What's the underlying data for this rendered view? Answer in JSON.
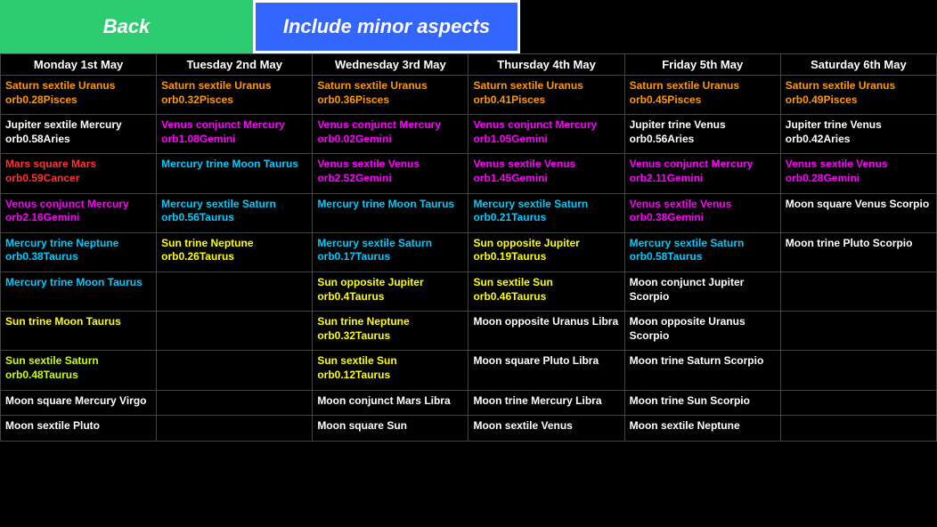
{
  "topbar": {
    "back_label": "Back",
    "minor_label": "Include minor aspects"
  },
  "headers": [
    "Monday 1st May",
    "Tuesday 2nd May",
    "Wednesday 3rd May",
    "Thursday 4th May",
    "Friday 5th May",
    "Saturday 6th May"
  ],
  "rows": [
    [
      [
        {
          "text": "Saturn sextile Uranus orb0.28Pisces",
          "color": "orange"
        }
      ],
      [
        {
          "text": "Saturn sextile Uranus orb0.32Pisces",
          "color": "orange"
        }
      ],
      [
        {
          "text": "Saturn sextile Uranus orb0.36Pisces",
          "color": "orange"
        }
      ],
      [
        {
          "text": "Saturn sextile Uranus orb0.41Pisces",
          "color": "orange"
        }
      ],
      [
        {
          "text": "Saturn sextile Uranus orb0.45Pisces",
          "color": "orange"
        }
      ],
      [
        {
          "text": "Saturn sextile Uranus orb0.49Pisces",
          "color": "orange"
        }
      ]
    ],
    [
      [
        {
          "text": "Jupiter sextile Mercury orb0.58Aries",
          "color": "white"
        }
      ],
      [
        {
          "text": "Venus conjunct Mercury orb1.08Gemini",
          "color": "magenta"
        }
      ],
      [
        {
          "text": "Venus conjunct Mercury orb0.02Gemini",
          "color": "magenta"
        }
      ],
      [
        {
          "text": "Venus conjunct Mercury orb1.05Gemini",
          "color": "magenta"
        }
      ],
      [
        {
          "text": "Jupiter trine Venus orb0.56Aries",
          "color": "white"
        }
      ],
      [
        {
          "text": "Jupiter trine Venus orb0.42Aries",
          "color": "white"
        }
      ]
    ],
    [
      [
        {
          "text": "Mars square Mars orb0.59Cancer",
          "color": "red"
        }
      ],
      [
        {
          "text": "Mercury trine Moon Taurus",
          "color": "cyan"
        }
      ],
      [
        {
          "text": "Venus sextile Venus orb2.52Gemini",
          "color": "magenta"
        }
      ],
      [
        {
          "text": "Venus sextile Venus orb1.45Gemini",
          "color": "magenta"
        }
      ],
      [
        {
          "text": "Venus conjunct Mercury orb2.11Gemini",
          "color": "magenta"
        }
      ],
      [
        {
          "text": "Venus sextile Venus orb0.28Gemini",
          "color": "magenta"
        }
      ]
    ],
    [
      [
        {
          "text": "Venus conjunct Mercury orb2.16Gemini",
          "color": "magenta"
        }
      ],
      [
        {
          "text": "Mercury sextile Saturn orb0.56Taurus",
          "color": "cyan"
        }
      ],
      [
        {
          "text": "Mercury trine Moon Taurus",
          "color": "cyan"
        }
      ],
      [
        {
          "text": "Mercury sextile Saturn orb0.21Taurus",
          "color": "cyan"
        }
      ],
      [
        {
          "text": "Venus sextile Venus orb0.38Gemini",
          "color": "magenta"
        }
      ],
      [
        {
          "text": "Moon square Venus Scorpio",
          "color": "white"
        }
      ]
    ],
    [
      [
        {
          "text": "Mercury trine Neptune orb0.38Taurus",
          "color": "cyan"
        }
      ],
      [
        {
          "text": "Sun trine Neptune orb0.26Taurus",
          "color": "yellow"
        }
      ],
      [
        {
          "text": "Mercury sextile Saturn orb0.17Taurus",
          "color": "cyan"
        }
      ],
      [
        {
          "text": "Sun opposite Jupiter orb0.19Taurus",
          "color": "yellow"
        }
      ],
      [
        {
          "text": "Mercury sextile Saturn orb0.58Taurus",
          "color": "cyan"
        }
      ],
      [
        {
          "text": "Moon trine Pluto Scorpio",
          "color": "white"
        }
      ]
    ],
    [
      [
        {
          "text": "Mercury trine Moon Taurus",
          "color": "cyan"
        }
      ],
      [],
      [
        {
          "text": "Sun opposite Jupiter orb0.4Taurus",
          "color": "yellow"
        }
      ],
      [
        {
          "text": "Sun sextile Sun orb0.46Taurus",
          "color": "yellow"
        }
      ],
      [
        {
          "text": "Moon conjunct Jupiter Scorpio",
          "color": "white"
        }
      ],
      []
    ],
    [
      [
        {
          "text": "Sun trine Moon Taurus",
          "color": "yellow"
        }
      ],
      [],
      [
        {
          "text": "Sun trine Neptune orb0.32Taurus",
          "color": "yellow"
        }
      ],
      [
        {
          "text": "Moon opposite Uranus Libra",
          "color": "white"
        }
      ],
      [
        {
          "text": "Moon opposite Uranus Scorpio",
          "color": "white"
        }
      ],
      []
    ],
    [
      [
        {
          "text": "Sun sextile Saturn orb0.48Taurus",
          "color": "lime"
        }
      ],
      [],
      [
        {
          "text": "Sun sextile Sun orb0.12Taurus",
          "color": "yellow"
        }
      ],
      [
        {
          "text": "Moon square Pluto Libra",
          "color": "white"
        }
      ],
      [
        {
          "text": "Moon trine Saturn Scorpio",
          "color": "white"
        }
      ],
      []
    ],
    [
      [
        {
          "text": "Moon square Mercury Virgo",
          "color": "white"
        }
      ],
      [],
      [
        {
          "text": "Moon conjunct Mars Libra",
          "color": "white"
        }
      ],
      [
        {
          "text": "Moon trine Mercury Libra",
          "color": "white"
        }
      ],
      [
        {
          "text": "Moon trine Sun Scorpio",
          "color": "white"
        }
      ],
      []
    ],
    [
      [
        {
          "text": "Moon sextile Pluto",
          "color": "white"
        }
      ],
      [],
      [
        {
          "text": "Moon square Sun",
          "color": "white"
        }
      ],
      [
        {
          "text": "Moon sextile Venus",
          "color": "white"
        }
      ],
      [
        {
          "text": "Moon sextile Neptune",
          "color": "white"
        }
      ],
      []
    ]
  ]
}
